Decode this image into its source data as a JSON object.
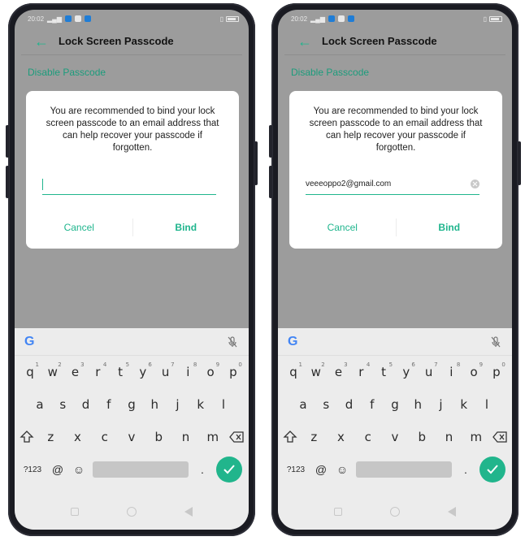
{
  "status": {
    "time": "20:02"
  },
  "screens": [
    {
      "appbar_title": "Lock Screen Passcode",
      "section_label": "Disable Passcode",
      "dialog": {
        "message": "You are recommended to bind your lock screen passcode to an email address that can help recover your passcode if forgotten.",
        "email_value": "",
        "cancel_label": "Cancel",
        "bind_label": "Bind"
      }
    },
    {
      "appbar_title": "Lock Screen Passcode",
      "section_label": "Disable Passcode",
      "dialog": {
        "message": "You are recommended to bind your lock screen passcode to an email address that can help recover your passcode if forgotten.",
        "email_value": "veeeoppo2@gmail.com",
        "cancel_label": "Cancel",
        "bind_label": "Bind"
      }
    }
  ],
  "keyboard": {
    "google_logo": "G",
    "row1": [
      {
        "k": "q",
        "n": "1"
      },
      {
        "k": "w",
        "n": "2"
      },
      {
        "k": "e",
        "n": "3"
      },
      {
        "k": "r",
        "n": "4"
      },
      {
        "k": "t",
        "n": "5"
      },
      {
        "k": "y",
        "n": "6"
      },
      {
        "k": "u",
        "n": "7"
      },
      {
        "k": "i",
        "n": "8"
      },
      {
        "k": "o",
        "n": "9"
      },
      {
        "k": "p",
        "n": "0"
      }
    ],
    "row2": [
      "a",
      "s",
      "d",
      "f",
      "g",
      "h",
      "j",
      "k",
      "l"
    ],
    "row3": [
      "z",
      "x",
      "c",
      "v",
      "b",
      "n",
      "m"
    ],
    "mode_label": "?123",
    "at_key": "@",
    "emoji_key": "☺",
    "period_key": "."
  },
  "colors": {
    "accent": "#1fb58d",
    "enter": "#21b58c",
    "dim": "#9c9c9c"
  }
}
